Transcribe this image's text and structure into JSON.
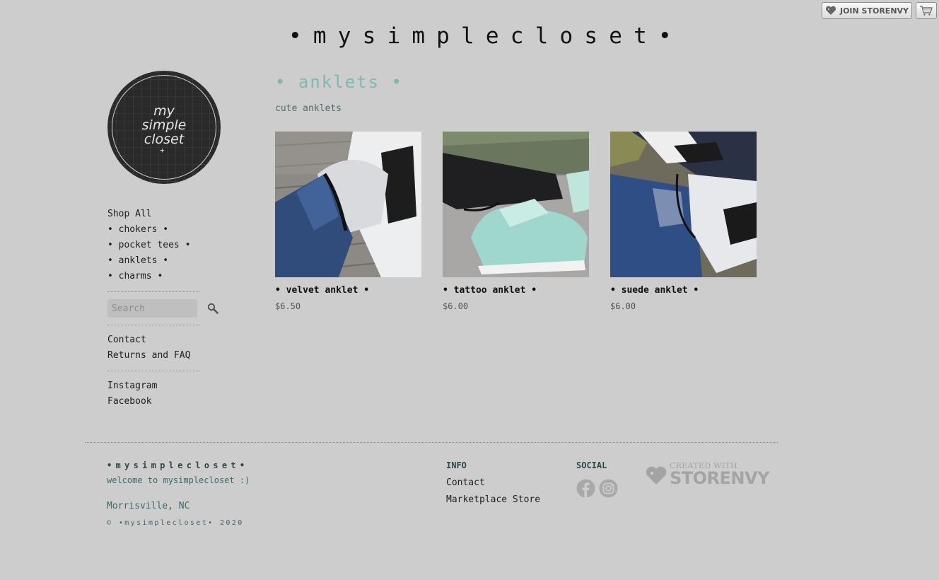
{
  "topbar": {
    "join_label": "JOIN STORENVY",
    "heart_icon": "heart-tag-icon",
    "cart_icon": "shopping-cart-icon"
  },
  "site": {
    "title": "•mysimplecloset•"
  },
  "logo": {
    "line1": "my",
    "line2": "simple",
    "line3": "closet",
    "mark": "+"
  },
  "sidebar": {
    "nav": [
      "Shop All",
      "• chokers •",
      "• pocket tees •",
      "• anklets •",
      "• charms •"
    ],
    "search_placeholder": "Search",
    "search_icon": "magnifier-icon",
    "info_links": [
      "Contact",
      "Returns and FAQ"
    ],
    "social_links": [
      "Instagram",
      "Facebook"
    ]
  },
  "category": {
    "title": "• anklets •",
    "description": "cute anklets"
  },
  "products": [
    {
      "name": "• velvet anklet •",
      "price": "$6.50"
    },
    {
      "name": "• tattoo anklet •",
      "price": "$6.00"
    },
    {
      "name": "• suede anklet •",
      "price": "$6.00"
    }
  ],
  "footer": {
    "brand": "•mysimplecloset•",
    "welcome": "welcome to mysimplecloset :)",
    "city": "Morrisville, NC",
    "copyright": "© •mysimplecloset• 2020",
    "info_heading": "INFO",
    "info_links": [
      "Contact",
      "Marketplace Store"
    ],
    "social_heading": "SOCIAL",
    "social_icons": [
      "facebook-icon",
      "instagram-icon"
    ],
    "created_small": "CREATED WITH",
    "created_big": "STORENVY"
  },
  "colors": {
    "page_bg": "#cdcdcd",
    "accent_teal": "#7fb8b1",
    "footer_text": "#3d6a67"
  }
}
